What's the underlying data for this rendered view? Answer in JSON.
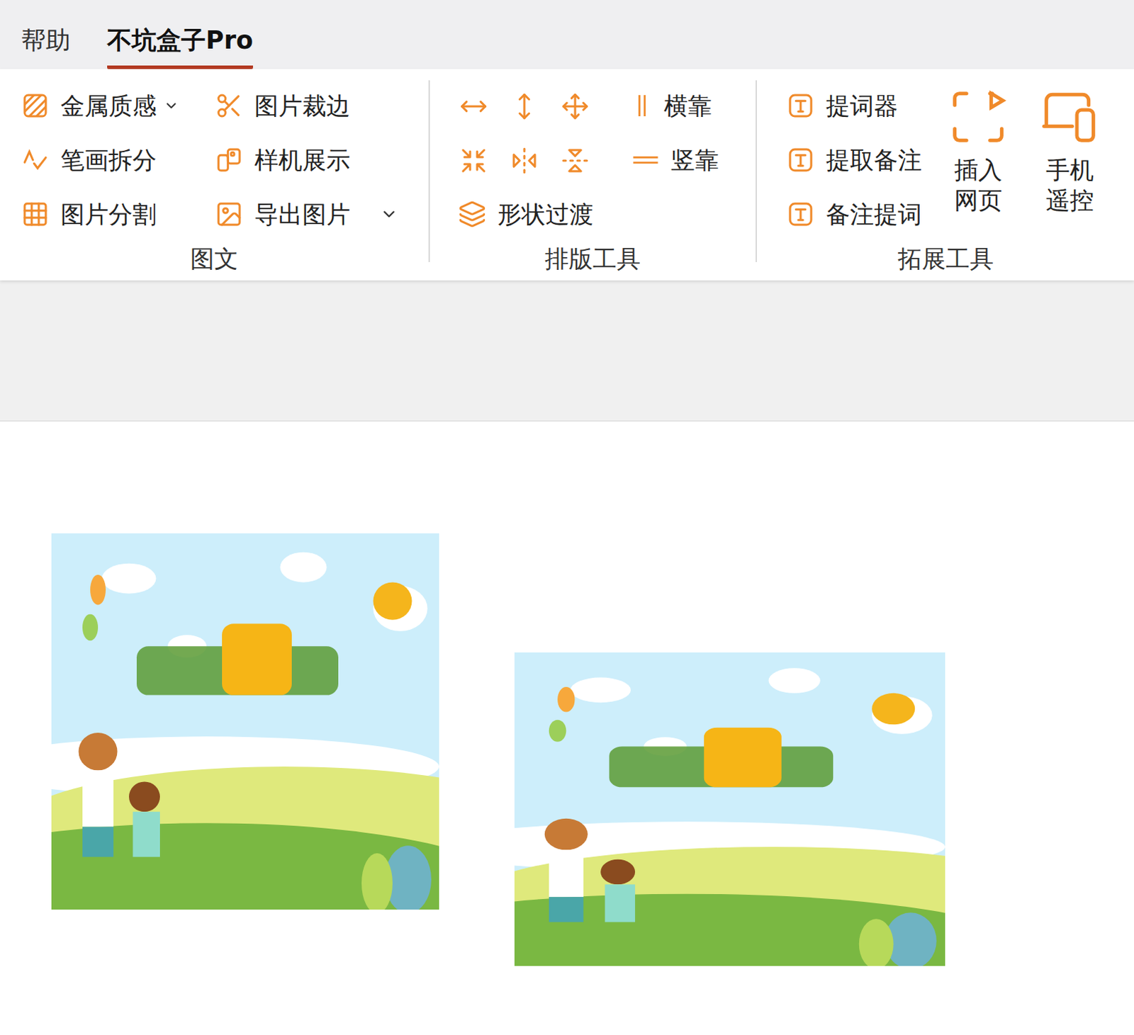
{
  "tabs": [
    {
      "label": "帮助",
      "selected": false
    },
    {
      "label": "不坑盒子Pro",
      "selected": true
    }
  ],
  "ribbon": {
    "groups": [
      {
        "label": "图文",
        "items": [
          {
            "label": "金属质感",
            "has_menu": true
          },
          {
            "label": "图片裁边",
            "has_menu": false
          },
          {
            "label": "笔画拆分",
            "has_menu": false
          },
          {
            "label": "样机展示",
            "has_menu": false
          },
          {
            "label": "图片分割",
            "has_menu": false
          },
          {
            "label": "导出图片",
            "has_menu": true
          }
        ]
      },
      {
        "label": "排版工具",
        "items": [
          {
            "label": "横靠"
          },
          {
            "label": "竖靠"
          },
          {
            "label": "形状过渡"
          }
        ]
      },
      {
        "label": "拓展工具",
        "items": [
          {
            "label": "提词器",
            "kind": "small"
          },
          {
            "label": "提取备注",
            "kind": "small"
          },
          {
            "label": "备注提词",
            "kind": "small"
          },
          {
            "label": "插入网页",
            "kind": "large"
          },
          {
            "label": "手机遥控",
            "kind": "large"
          }
        ]
      }
    ]
  }
}
